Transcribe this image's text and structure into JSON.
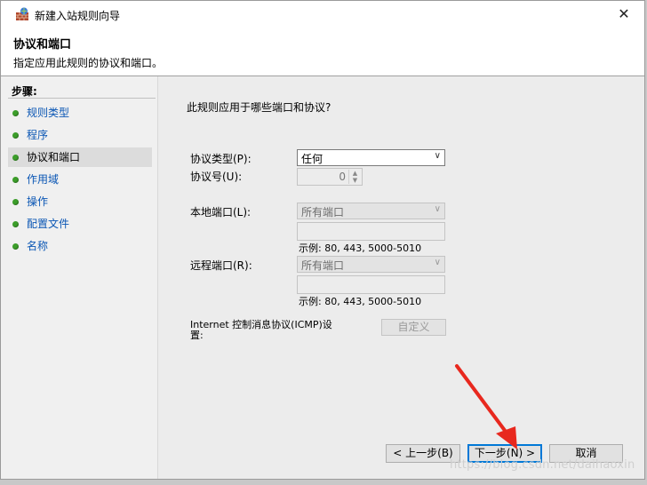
{
  "window": {
    "title": "新建入站规则向导",
    "close_glyph": "✕"
  },
  "header": {
    "title": "协议和端口",
    "subtitle": "指定应用此规则的协议和端口。"
  },
  "sidebar": {
    "steps_label": "步骤:",
    "items": [
      {
        "label": "规则类型"
      },
      {
        "label": "程序"
      },
      {
        "label": "协议和端口"
      },
      {
        "label": "作用域"
      },
      {
        "label": "操作"
      },
      {
        "label": "配置文件"
      },
      {
        "label": "名称"
      }
    ],
    "active_item": "协议和端口",
    "dot_color": "#3c9e2a",
    "link_color": "#0a56b4"
  },
  "main": {
    "question": "此规则应用于哪些端口和协议?",
    "protocol_type_label": "协议类型(P):",
    "protocol_type_value": "任何",
    "protocol_number_label": "协议号(U):",
    "protocol_number_value": "0",
    "local_port_label": "本地端口(L):",
    "local_port_value": "所有端口",
    "local_example": "示例: 80, 443, 5000-5010",
    "remote_port_label": "远程端口(R):",
    "remote_port_value": "所有端口",
    "remote_example": "示例: 80, 443, 5000-5010",
    "icmp_label_line1": "Internet 控制消息协议(ICMP)设",
    "icmp_label_line2": "置:",
    "custom_button": "自定义"
  },
  "footer": {
    "back_button": "< 上一步(B)",
    "next_button": "下一步(N) >",
    "cancel_button": "取消"
  },
  "watermark": "https://blog.csdn.net/daihaoxin",
  "annotation": {
    "color": "#e8281e"
  }
}
